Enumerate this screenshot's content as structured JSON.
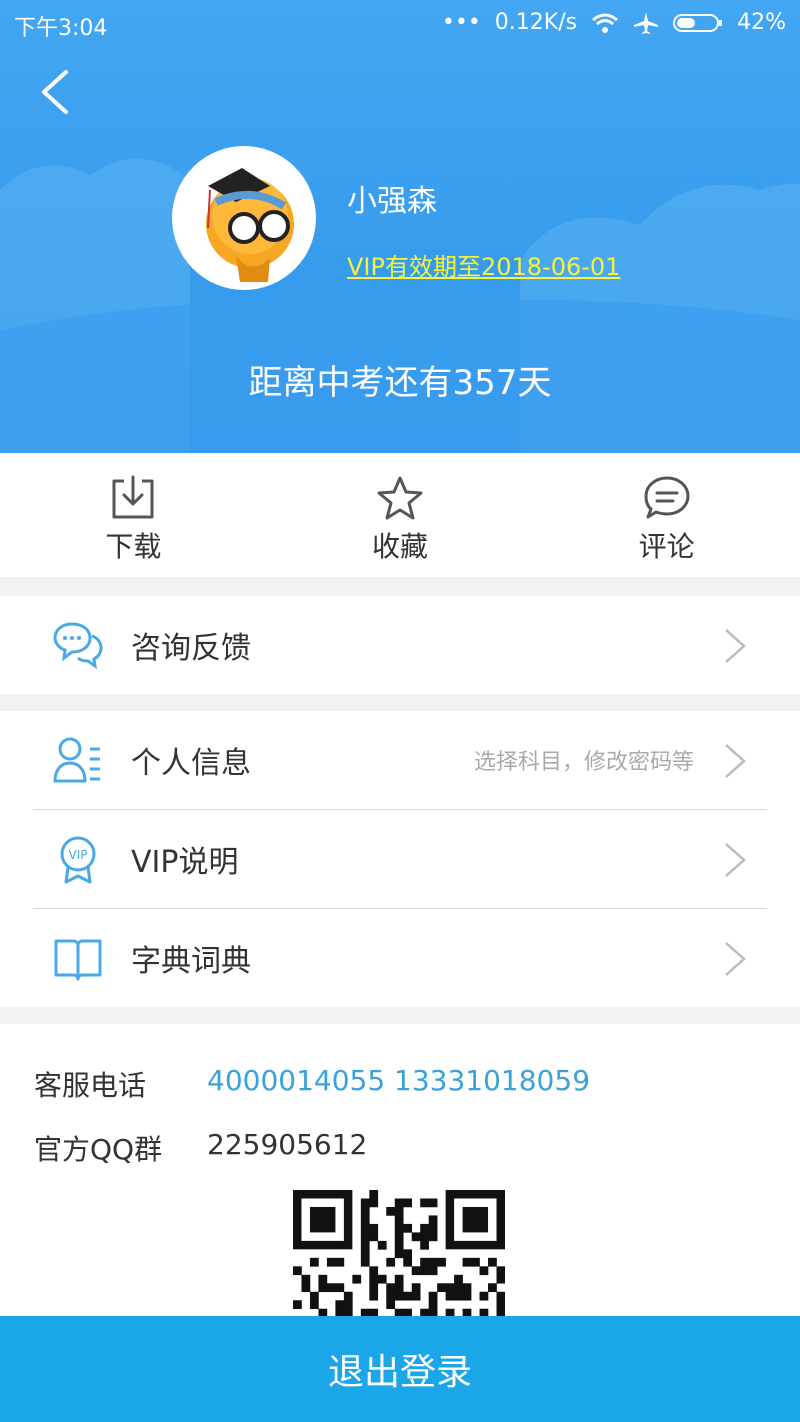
{
  "status_bar": {
    "time": "下午3:04",
    "dots": "•••",
    "speed": "0.12K/s",
    "battery": "42%",
    "icons": [
      "wifi-icon",
      "airplane-icon",
      "battery-icon"
    ]
  },
  "header": {
    "username": "小强森",
    "vip_expiry": "VIP有效期至2018-06-01",
    "countdown": "距离中考还有357天"
  },
  "quick_actions": [
    {
      "label": "下载",
      "icon": "download-icon"
    },
    {
      "label": "收藏",
      "icon": "star-icon"
    },
    {
      "label": "评论",
      "icon": "comment-icon"
    }
  ],
  "menu": {
    "feedback": {
      "label": "咨询反馈",
      "icon": "chat-bubbles-icon"
    },
    "profile": {
      "label": "个人信息",
      "hint": "选择科目，修改密码等",
      "icon": "user-list-icon"
    },
    "vip": {
      "label": "VIP说明",
      "icon": "vip-badge-icon"
    },
    "dictionary": {
      "label": "字典词典",
      "icon": "book-icon"
    }
  },
  "contact": {
    "phone_label": "客服电话",
    "phone_values": "4000014055  13331018059",
    "qq_label": "官方QQ群",
    "qq_value": "225905612"
  },
  "logout_label": "退出登录",
  "colors": {
    "header_blue": "#2f95ea",
    "vip_yellow": "#f6f33a",
    "link_blue": "#3aa2d8",
    "logout_blue": "#1aa6e8"
  }
}
